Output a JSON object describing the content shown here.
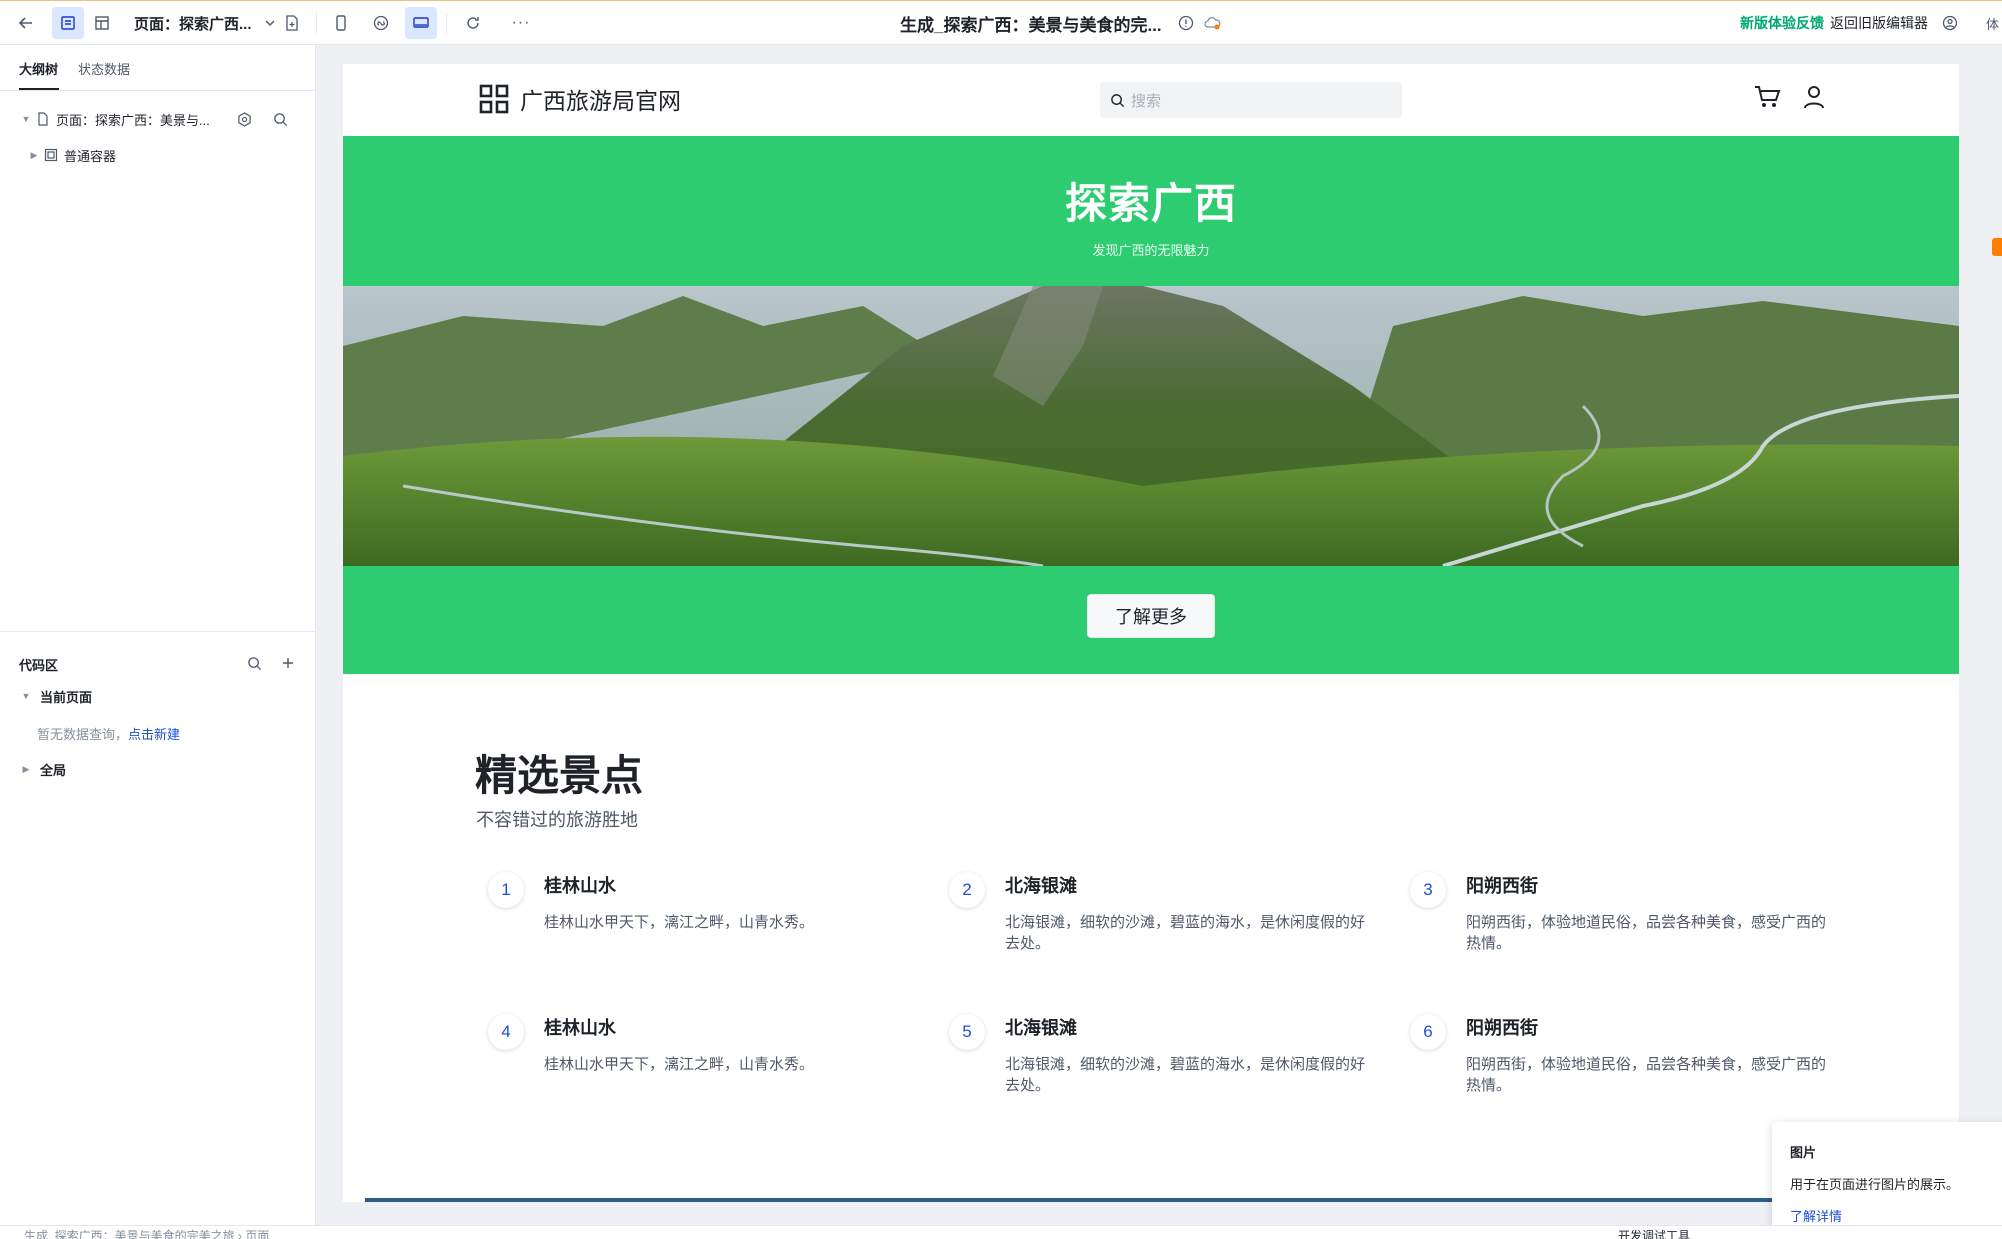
{
  "topbar": {
    "page_selector": "页面：探索广西...",
    "doc_title": "生成_探索广西：美景与美食的完...",
    "feedback": "新版体验反馈",
    "old_editor": "返回旧版编辑器",
    "cut_label": "体"
  },
  "left_panel": {
    "tabs": [
      "大纲树",
      "状态数据"
    ],
    "tree": {
      "page_label": "页面：探索广西：美景与...",
      "container_label": "普通容器"
    },
    "code_area": {
      "title": "代码区",
      "current_page": "当前页面",
      "empty_text": "暂无数据查询，",
      "create_link": "点击新建",
      "global": "全局"
    }
  },
  "site": {
    "brand": "广西旅游局官网",
    "search_placeholder": "搜索",
    "hero": {
      "title": "探索广西",
      "subtitle": "发现广西的无限魅力",
      "button": "了解更多"
    },
    "section": {
      "title": "精选景点",
      "subtitle": "不容错过的旅游胜地"
    },
    "cards": [
      {
        "num": "1",
        "title": "桂林山水",
        "desc": "桂林山水甲天下，漓江之畔，山青水秀。"
      },
      {
        "num": "2",
        "title": "北海银滩",
        "desc": "北海银滩，细软的沙滩，碧蓝的海水，是休闲度假的好去处。"
      },
      {
        "num": "3",
        "title": "阳朔西街",
        "desc": "阳朔西街，体验地道民俗，品尝各种美食，感受广西的热情。"
      },
      {
        "num": "4",
        "title": "桂林山水",
        "desc": "桂林山水甲天下，漓江之畔，山青水秀。"
      },
      {
        "num": "5",
        "title": "北海银滩",
        "desc": "北海银滩，细软的沙滩，碧蓝的海水，是休闲度假的好去处。"
      },
      {
        "num": "6",
        "title": "阳朔西街",
        "desc": "阳朔西街，体验地道民俗，品尝各种美食，感受广西的热情。"
      }
    ]
  },
  "popover": {
    "title": "图片",
    "desc": "用于在页面进行图片的展示。",
    "link": "了解详情"
  },
  "bottom": {
    "breadcrumb": "生成_探索广西：美景与美食的完美之旅 › 页面",
    "devtools": "开发调试工具"
  },
  "colors": {
    "hero_green": "#2ecc71",
    "link_blue": "#1d4ed8",
    "feedback_green": "#00a870",
    "accent_orange": "#ff7d00"
  },
  "icons": [
    "back-arrow-icon",
    "outline-icon",
    "layout-icon",
    "chevron-down-icon",
    "page-add-icon",
    "mobile-icon",
    "miniapp-icon",
    "desktop-icon",
    "refresh-icon",
    "more-icon",
    "info-icon",
    "cloud-status-icon",
    "user-icon",
    "file-icon",
    "container-icon",
    "settings-icon",
    "search-icon",
    "plus-icon",
    "grid-logo-icon",
    "cart-icon"
  ]
}
